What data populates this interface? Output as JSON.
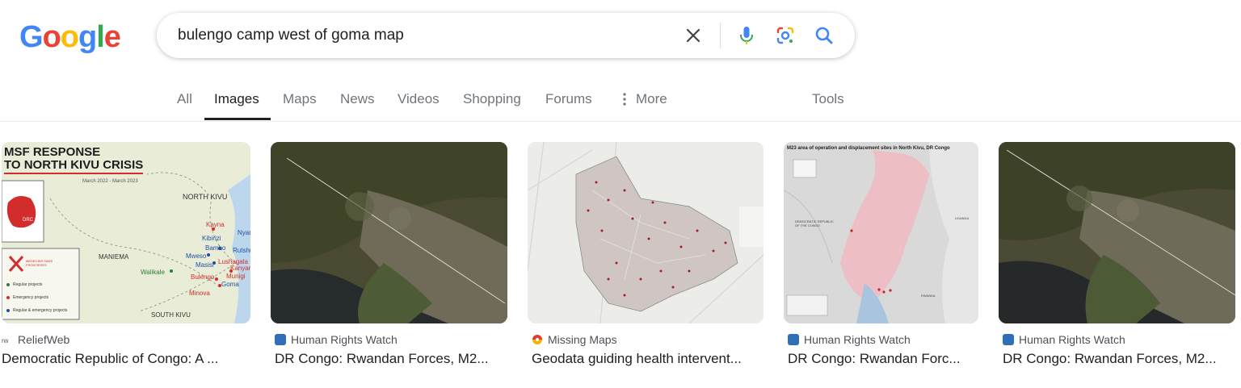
{
  "logo": {
    "letters": [
      "G",
      "o",
      "o",
      "g",
      "l",
      "e"
    ],
    "colors": [
      "#4285f4",
      "#ea4335",
      "#fbbc05",
      "#4285f4",
      "#34a853",
      "#ea4335"
    ]
  },
  "search": {
    "query": "bulengo camp west of goma map"
  },
  "tabs": [
    {
      "label": "All"
    },
    {
      "label": "Images"
    },
    {
      "label": "Maps"
    },
    {
      "label": "News"
    },
    {
      "label": "Videos"
    },
    {
      "label": "Shopping"
    },
    {
      "label": "Forums"
    },
    {
      "label": "More"
    }
  ],
  "tools_label": "Tools",
  "results": [
    {
      "source": "ReliefWeb",
      "title": "Democratic Republic of Congo: A ...",
      "icon": "reliefweb-icon",
      "map": {
        "title_line1": "MSF RESPONSE",
        "title_line2": "TO NORTH KIVU CRISIS",
        "date": "March 2022 - March 2023",
        "labels": [
          "NORTH KIVU",
          "MANIEMA",
          "SOUTH KIVU",
          "DRC",
          "Walikale",
          "Kayna",
          "Kibirizi",
          "Bambo",
          "Mweso",
          "Masisi",
          "Bulengo",
          "Minova",
          "Lushagala",
          "Kanyaruchinya",
          "Munigi",
          "Goma",
          "Rutshuru",
          "Nyamilima"
        ],
        "legend": [
          "MEDECINS SANS FRONTIERES",
          "Regular projects",
          "Emergency projects",
          "Regular & emergency projects"
        ]
      }
    },
    {
      "source": "Human Rights Watch",
      "title": "DR Congo: Rwandan Forces, M2...",
      "icon": "hrw-icon"
    },
    {
      "source": "Missing Maps",
      "title": "Geodata guiding health intervent...",
      "icon": "missing-maps-icon"
    },
    {
      "source": "Human Rights Watch",
      "title": "DR Congo: Rwandan Forc...",
      "icon": "hrw-icon",
      "map": {
        "heading": "M23 area of operation and displacement sites in North Kivu, DR Congo",
        "labels": [
          "DEMOCRATIC REPUBLIC OF THE CONGO",
          "UGANDA",
          "RWANDA"
        ]
      }
    },
    {
      "source": "Human Rights Watch",
      "title": "DR Congo: Rwandan Forces, M2...",
      "icon": "hrw-icon"
    }
  ],
  "colors": {
    "hrw_blue": "#2f6fb7",
    "msf_red": "#d22c2c",
    "tab_active": "#202124",
    "tab_inactive": "#70757a"
  }
}
